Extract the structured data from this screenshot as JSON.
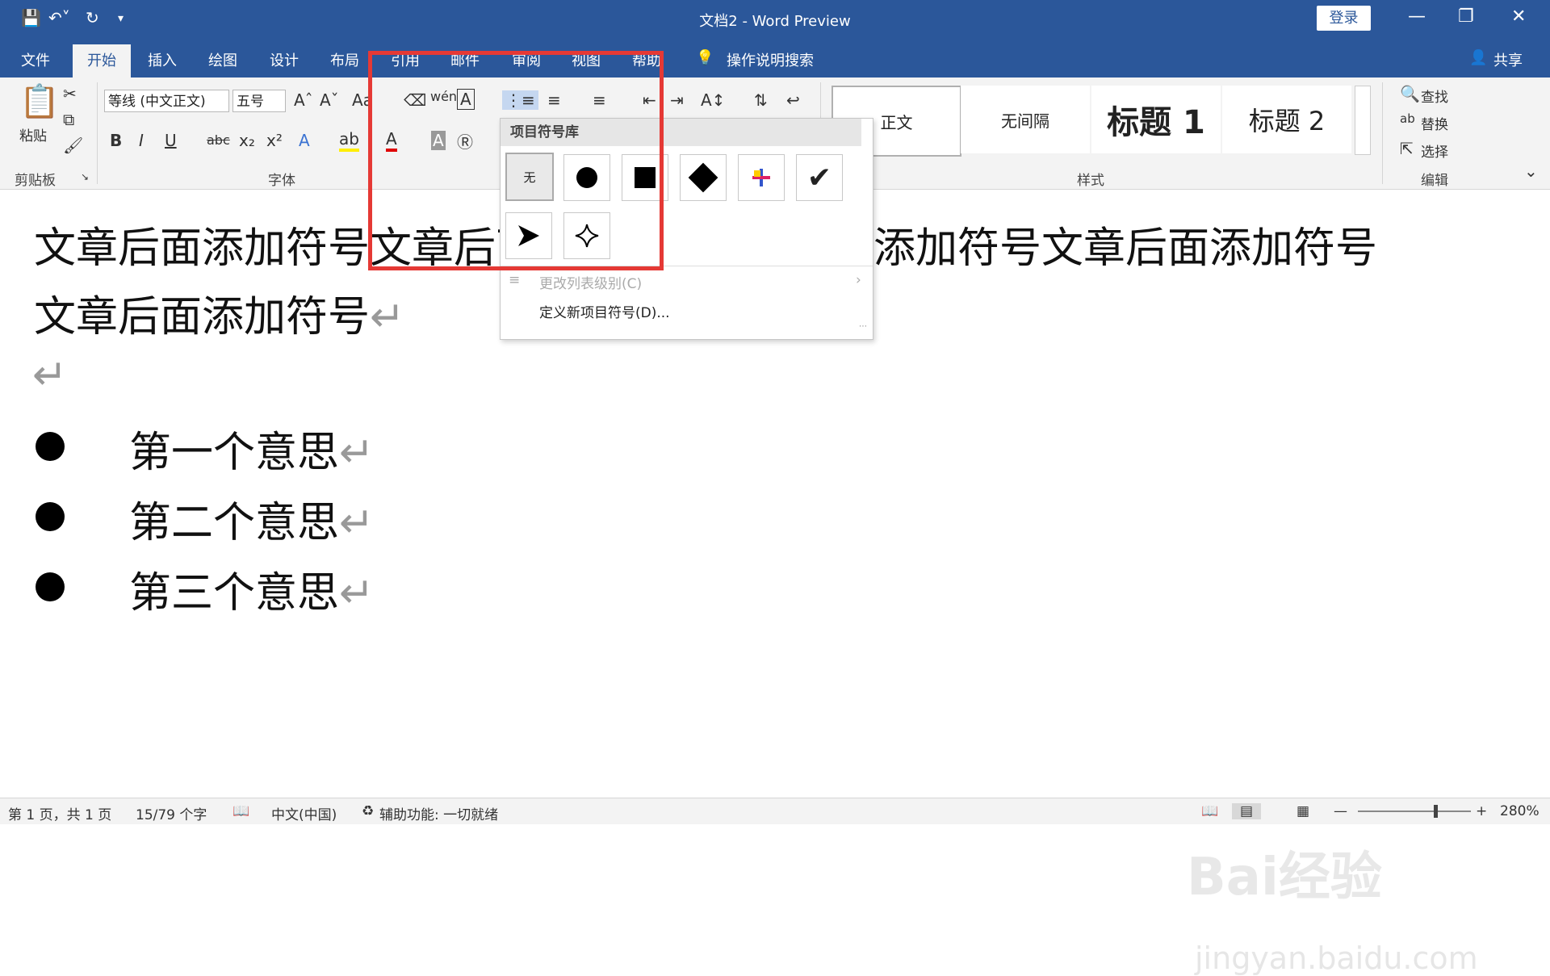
{
  "titlebar": {
    "title": "文档2  -  Word Preview",
    "login": "登录"
  },
  "tabs": [
    {
      "label": "文件"
    },
    {
      "label": "开始"
    },
    {
      "label": "插入"
    },
    {
      "label": "绘图"
    },
    {
      "label": "设计"
    },
    {
      "label": "布局"
    },
    {
      "label": "引用"
    },
    {
      "label": "邮件"
    },
    {
      "label": "审阅"
    },
    {
      "label": "视图"
    },
    {
      "label": "帮助"
    }
  ],
  "tell_me": "操作说明搜索",
  "share": "共享",
  "ribbon": {
    "clipboard": {
      "paste": "粘贴",
      "group": "剪贴板"
    },
    "font": {
      "family": "等线 (中文正文)",
      "size": "五号",
      "group": "字体"
    },
    "styles": {
      "normal": "正文",
      "nospacing": "无间隔",
      "h1": "标题 1",
      "h2": "标题 2",
      "group": "样式"
    },
    "editing": {
      "find": "查找",
      "replace": "替换",
      "select": "选择",
      "group": "编辑"
    }
  },
  "dropdown": {
    "header": "项目符号库",
    "none_label": "无",
    "change_level": "更改列表级别(C)",
    "define_new": "定义新项目符号(D)..."
  },
  "document": {
    "line1": "文章后面添加符号文章后面添加符号文章后面添加符号文章后面添加符号",
    "line2": "文章后面添加符号",
    "items": [
      "第一个意思",
      "第二个意思",
      "第三个意思"
    ],
    "return_mark": "↵"
  },
  "status": {
    "page": "第 1 页，共 1 页",
    "words": "15/79 个字",
    "lang": "中文(中国)",
    "access": "辅助功能: 一切就绪",
    "zoom": "280%"
  },
  "watermark": {
    "brand": "Bai经验",
    "url": "jingyan.baidu.com"
  }
}
